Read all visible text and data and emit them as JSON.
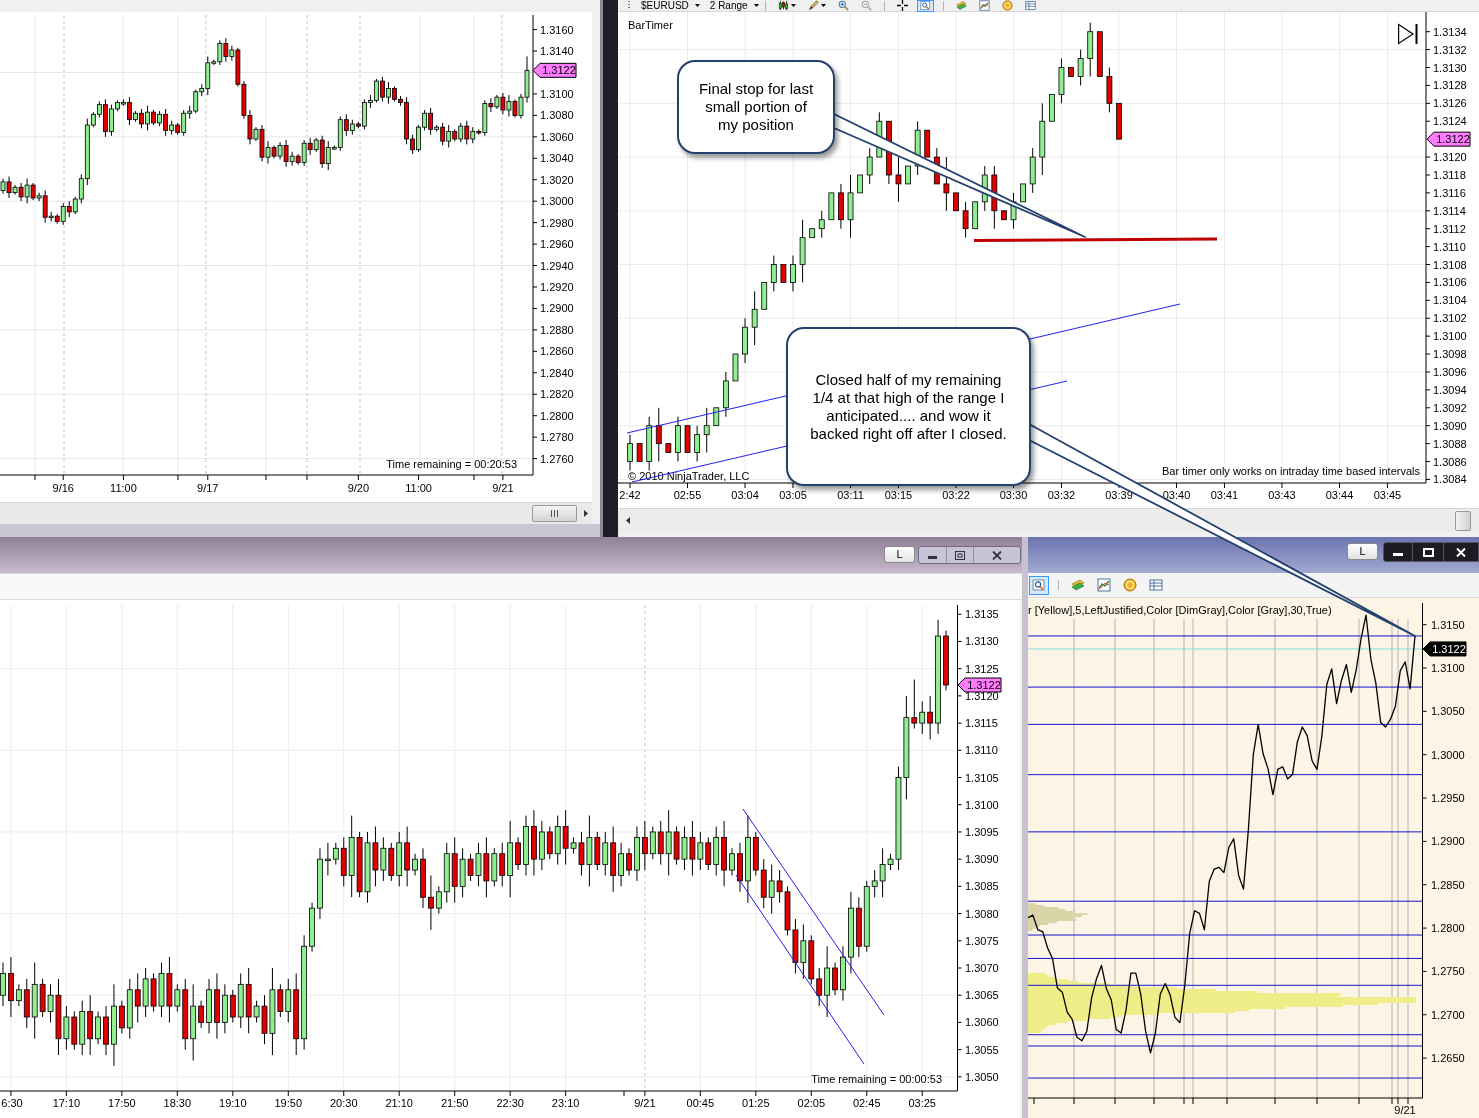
{
  "top_left_window": {
    "last_price": "1.3122",
    "timer": "Time remaining = 00:20:53",
    "chart_data": {
      "type": "candlestick",
      "grid": true,
      "ylim": [
        1.27447,
        1.31736
      ],
      "yticks": [
        {
          "value": 1.316,
          "label": "1.3160"
        },
        {
          "value": 1.314,
          "label": "1.3140"
        },
        {
          "value": 1.31,
          "label": "1.3100"
        },
        {
          "value": 1.308,
          "label": "1.3080"
        },
        {
          "value": 1.306,
          "label": "1.3060"
        },
        {
          "value": 1.304,
          "label": "1.3040"
        },
        {
          "value": 1.302,
          "label": "1.3020"
        },
        {
          "value": 1.3,
          "label": "1.3000"
        },
        {
          "value": 1.298,
          "label": "1.2980"
        },
        {
          "value": 1.296,
          "label": "1.2960"
        },
        {
          "value": 1.294,
          "label": "1.2940"
        },
        {
          "value": 1.292,
          "label": "1.2920"
        },
        {
          "value": 1.29,
          "label": "1.2900"
        },
        {
          "value": 1.288,
          "label": "1.2880"
        },
        {
          "value": 1.286,
          "label": "1.2860"
        },
        {
          "value": 1.284,
          "label": "1.2840"
        },
        {
          "value": 1.282,
          "label": "1.2820"
        },
        {
          "value": 1.28,
          "label": "1.2800"
        },
        {
          "value": 1.278,
          "label": "1.2780"
        },
        {
          "value": 1.276,
          "label": "1.2760"
        }
      ],
      "categories": [
        null,
        null,
        null,
        null,
        null,
        null,
        null,
        null,
        null,
        null,
        "9/16",
        null,
        null,
        null,
        null,
        null,
        null,
        null,
        null,
        null,
        "11:00",
        null,
        null,
        null,
        null,
        null,
        null,
        null,
        null,
        null,
        null,
        null,
        null,
        null,
        "9/17",
        null,
        null,
        null,
        null,
        null,
        null,
        null,
        null,
        null,
        null,
        null,
        null,
        null,
        null,
        null,
        null,
        null,
        null,
        null,
        null,
        null,
        null,
        null,
        null,
        "9/20",
        null,
        null,
        null,
        null,
        null,
        null,
        null,
        null,
        null,
        "11:00",
        null,
        null,
        null,
        null,
        null,
        null,
        null,
        null,
        null,
        null,
        null,
        null,
        null,
        "9/21",
        null,
        null,
        null,
        null
      ],
      "ohlc": [
        [
          1.301,
          1.3021,
          1.3007,
          1.3018
        ],
        [
          1.3018,
          1.3023,
          1.3003,
          1.3008
        ],
        [
          1.3008,
          1.3015,
          1.3006,
          1.3013
        ],
        [
          1.3013,
          1.3017,
          1.3,
          1.3004
        ],
        [
          1.3004,
          1.3021,
          1.2998,
          1.3015
        ],
        [
          1.3015,
          1.3017,
          1.3001,
          1.3003
        ],
        [
          1.3003,
          1.3008,
          1.3,
          1.3005
        ],
        [
          1.3005,
          1.301,
          1.298,
          1.2985
        ],
        [
          1.2985,
          1.299,
          1.2981,
          1.2986
        ],
        [
          1.2986,
          1.2988,
          1.2979,
          1.2981
        ],
        [
          1.2981,
          1.2998,
          1.2978,
          1.2995
        ],
        [
          1.2995,
          1.3,
          1.2985,
          1.299
        ],
        [
          1.299,
          1.3004,
          1.2988,
          1.3002
        ],
        [
          1.3002,
          1.3025,
          1.2998,
          1.3021
        ],
        [
          1.3021,
          1.3077,
          1.3015,
          1.3071
        ],
        [
          1.3071,
          1.3083,
          1.3069,
          1.3081
        ],
        [
          1.3081,
          1.3093,
          1.3078,
          1.309
        ],
        [
          1.309,
          1.3095,
          1.306,
          1.3065
        ],
        [
          1.3065,
          1.309,
          1.3061,
          1.3086
        ],
        [
          1.3086,
          1.3094,
          1.3084,
          1.3092
        ],
        [
          1.3092,
          1.3095,
          1.3089,
          1.3092
        ],
        [
          1.3092,
          1.3097,
          1.3071,
          1.3076
        ],
        [
          1.3076,
          1.3084,
          1.3074,
          1.3082
        ],
        [
          1.3082,
          1.3086,
          1.3068,
          1.3072
        ],
        [
          1.3072,
          1.3089,
          1.3066,
          1.3083
        ],
        [
          1.3083,
          1.3085,
          1.3071,
          1.3073
        ],
        [
          1.3073,
          1.3084,
          1.307,
          1.3081
        ],
        [
          1.3081,
          1.3086,
          1.3061,
          1.3066
        ],
        [
          1.3066,
          1.3075,
          1.3062,
          1.3071
        ],
        [
          1.3071,
          1.3073,
          1.3062,
          1.3064
        ],
        [
          1.3064,
          1.3085,
          1.3061,
          1.3082
        ],
        [
          1.3082,
          1.3089,
          1.3077,
          1.3084
        ],
        [
          1.3084,
          1.3104,
          1.3082,
          1.3102
        ],
        [
          1.3102,
          1.3109,
          1.3098,
          1.3105
        ],
        [
          1.3105,
          1.3135,
          1.3099,
          1.3129
        ],
        [
          1.3129,
          1.3132,
          1.3127,
          1.313
        ],
        [
          1.313,
          1.315,
          1.3127,
          1.3147
        ],
        [
          1.3147,
          1.3152,
          1.313,
          1.3135
        ],
        [
          1.3135,
          1.3145,
          1.3131,
          1.3141
        ],
        [
          1.3141,
          1.3143,
          1.3107,
          1.3109
        ],
        [
          1.3109,
          1.3112,
          1.3077,
          1.308
        ],
        [
          1.308,
          1.3085,
          1.3053,
          1.3058
        ],
        [
          1.3058,
          1.3069,
          1.3056,
          1.3067
        ],
        [
          1.3067,
          1.3071,
          1.3037,
          1.3041
        ],
        [
          1.3041,
          1.3056,
          1.3035,
          1.305
        ],
        [
          1.305,
          1.3052,
          1.304,
          1.3042
        ],
        [
          1.3042,
          1.3055,
          1.3039,
          1.3052
        ],
        [
          1.3052,
          1.3057,
          1.3032,
          1.3037
        ],
        [
          1.3037,
          1.3046,
          1.3033,
          1.3042
        ],
        [
          1.3042,
          1.3044,
          1.3034,
          1.3036
        ],
        [
          1.3036,
          1.3057,
          1.3033,
          1.3054
        ],
        [
          1.3054,
          1.3059,
          1.3043,
          1.3048
        ],
        [
          1.3048,
          1.3059,
          1.3046,
          1.3057
        ],
        [
          1.3057,
          1.3061,
          1.3031,
          1.3035
        ],
        [
          1.3035,
          1.3056,
          1.3029,
          1.305
        ],
        [
          1.305,
          1.3052,
          1.3048,
          1.305
        ],
        [
          1.305,
          1.3079,
          1.3047,
          1.3076
        ],
        [
          1.3076,
          1.3081,
          1.3061,
          1.3066
        ],
        [
          1.3066,
          1.3076,
          1.3062,
          1.3072
        ],
        [
          1.3072,
          1.3074,
          1.3068,
          1.307
        ],
        [
          1.307,
          1.3095,
          1.3067,
          1.3092
        ],
        [
          1.3092,
          1.3099,
          1.3087,
          1.3094
        ],
        [
          1.3094,
          1.3114,
          1.3092,
          1.3112
        ],
        [
          1.3112,
          1.3116,
          1.3093,
          1.3097
        ],
        [
          1.3097,
          1.3111,
          1.3091,
          1.3105
        ],
        [
          1.3105,
          1.3107,
          1.3093,
          1.3095
        ],
        [
          1.3095,
          1.3098,
          1.3089,
          1.3092
        ],
        [
          1.3092,
          1.3097,
          1.3053,
          1.3058
        ],
        [
          1.3058,
          1.3062,
          1.3044,
          1.3048
        ],
        [
          1.3048,
          1.3071,
          1.3046,
          1.3069
        ],
        [
          1.3069,
          1.3085,
          1.3066,
          1.3082
        ],
        [
          1.3082,
          1.3087,
          1.3062,
          1.3067
        ],
        [
          1.3067,
          1.3071,
          1.3065,
          1.3069
        ],
        [
          1.3069,
          1.3073,
          1.3052,
          1.3056
        ],
        [
          1.3056,
          1.3071,
          1.305,
          1.3065
        ],
        [
          1.3065,
          1.3067,
          1.3056,
          1.3058
        ],
        [
          1.3058,
          1.3073,
          1.3055,
          1.307
        ],
        [
          1.307,
          1.3075,
          1.3053,
          1.3058
        ],
        [
          1.3058,
          1.3069,
          1.3054,
          1.3065
        ],
        [
          1.3065,
          1.3067,
          1.3062,
          1.3064
        ],
        [
          1.3064,
          1.3094,
          1.3061,
          1.3091
        ],
        [
          1.3091,
          1.3096,
          1.3083,
          1.3088
        ],
        [
          1.3088,
          1.3099,
          1.3086,
          1.3097
        ],
        [
          1.3097,
          1.3101,
          1.3081,
          1.3085
        ],
        [
          1.3085,
          1.3099,
          1.3079,
          1.3093
        ],
        [
          1.3093,
          1.3095,
          1.3078,
          1.308
        ],
        [
          1.308,
          1.31,
          1.3077,
          1.3097
        ],
        [
          1.3097,
          1.3135,
          1.3092,
          1.3122
        ]
      ]
    }
  },
  "top_right_window": {
    "toolbar": {
      "instrument": "$EURUSD",
      "interval": "2 Range"
    },
    "tools": [
      {
        "kind": "candles",
        "selected": false
      },
      {
        "kind": "pencil",
        "selected": false
      },
      {
        "kind": "zoom-in",
        "selected": false
      },
      {
        "kind": "zoom-out",
        "selected": false
      },
      {
        "kind": "crosshair",
        "selected": false
      },
      {
        "kind": "magnifier",
        "selected": true
      },
      {
        "kind": "banknotes",
        "selected": false
      },
      {
        "kind": "line-chart",
        "selected": false
      },
      {
        "kind": "coin",
        "selected": false
      },
      {
        "kind": "table",
        "selected": false
      }
    ],
    "indicator": "BarTimer",
    "last_price": "1.3122",
    "copyright": "© 2010 NinjaTrader, LLC",
    "notice": "Bar timer only works on intraday time based intervals",
    "chart_data": {
      "type": "candlestick",
      "grid": true,
      "ylim": [
        1.30836,
        1.31362
      ],
      "yticks": [
        {
          "value": 1.3134,
          "label": "1.3134"
        },
        {
          "value": 1.3132,
          "label": "1.3132"
        },
        {
          "value": 1.313,
          "label": "1.3130"
        },
        {
          "value": 1.3128,
          "label": "1.3128"
        },
        {
          "value": 1.3126,
          "label": "1.3126"
        },
        {
          "value": 1.3124,
          "label": "1.3124"
        },
        {
          "value": 1.312,
          "label": "1.3120"
        },
        {
          "value": 1.3118,
          "label": "1.3118"
        },
        {
          "value": 1.3116,
          "label": "1.3116"
        },
        {
          "value": 1.3114,
          "label": "1.3114"
        },
        {
          "value": 1.3112,
          "label": "1.3112"
        },
        {
          "value": 1.311,
          "label": "1.3110"
        },
        {
          "value": 1.3108,
          "label": "1.3108"
        },
        {
          "value": 1.3106,
          "label": "1.3106"
        },
        {
          "value": 1.3104,
          "label": "1.3104"
        },
        {
          "value": 1.3102,
          "label": "1.3102"
        },
        {
          "value": 1.31,
          "label": "1.3100"
        },
        {
          "value": 1.3098,
          "label": "1.3098"
        },
        {
          "value": 1.3096,
          "label": "1.3096"
        },
        {
          "value": 1.3094,
          "label": "1.3094"
        },
        {
          "value": 1.3092,
          "label": "1.3092"
        },
        {
          "value": 1.309,
          "label": "1.3090"
        },
        {
          "value": 1.3088,
          "label": "1.3088"
        },
        {
          "value": 1.3086,
          "label": "1.3086"
        },
        {
          "value": 1.3084,
          "label": "1.3084"
        }
      ],
      "categories": [
        "2:42",
        null,
        null,
        null,
        null,
        null,
        "02:55",
        null,
        null,
        null,
        null,
        null,
        "03:04",
        null,
        null,
        null,
        null,
        "03:05",
        null,
        null,
        null,
        null,
        null,
        "03:11",
        null,
        null,
        null,
        null,
        "03:15",
        null,
        null,
        null,
        null,
        null,
        "03:22",
        null,
        null,
        null,
        null,
        null,
        "03:30",
        null,
        null,
        null,
        null,
        "03:32",
        null,
        null,
        null,
        null,
        null,
        "03:39",
        null,
        null,
        null,
        null,
        null,
        "03:40",
        null,
        null,
        null,
        null,
        "03:41",
        null,
        null,
        null,
        null,
        null,
        "03:43",
        null,
        null,
        null,
        null,
        null,
        "03:44",
        null,
        null,
        null,
        null,
        "03:45",
        null,
        null,
        null,
        null
      ],
      "ohlc": [
        [
          1.3086,
          1.3089,
          1.3085,
          1.3088
        ],
        [
          1.3088,
          1.3088,
          1.3086,
          1.3086
        ],
        [
          1.3086,
          1.3091,
          1.3085,
          1.309
        ],
        [
          1.309,
          1.3092,
          1.3086,
          1.3088
        ],
        [
          1.3088,
          1.3088,
          1.3087,
          1.3087
        ],
        [
          1.3087,
          1.3091,
          1.3086,
          1.309
        ],
        [
          1.309,
          1.309,
          1.3087,
          1.3087
        ],
        [
          1.3087,
          1.309,
          1.3086,
          1.3089
        ],
        [
          1.3089,
          1.3092,
          1.3087,
          1.309
        ],
        [
          1.309,
          1.3092,
          1.309,
          1.3092
        ],
        [
          1.3092,
          1.3096,
          1.3091,
          1.3095
        ],
        [
          1.3095,
          1.3098,
          1.3095,
          1.3098
        ],
        [
          1.3098,
          1.3102,
          1.3097,
          1.3101
        ],
        [
          1.3101,
          1.3105,
          1.3099,
          1.3103
        ],
        [
          1.3103,
          1.3106,
          1.3103,
          1.3106
        ],
        [
          1.3106,
          1.3109,
          1.3105,
          1.3108
        ],
        [
          1.3108,
          1.3108,
          1.3106,
          1.3106
        ],
        [
          1.3106,
          1.3109,
          1.3105,
          1.3108
        ],
        [
          1.3108,
          1.3113,
          1.3106,
          1.3111
        ],
        [
          1.3111,
          1.3112,
          1.3111,
          1.3112
        ],
        [
          1.3112,
          1.3114,
          1.3111,
          1.3113
        ],
        [
          1.3113,
          1.3116,
          1.3113,
          1.3116
        ],
        [
          1.3116,
          1.3117,
          1.3112,
          1.3113
        ],
        [
          1.3113,
          1.3118,
          1.3111,
          1.3116
        ],
        [
          1.3116,
          1.3118,
          1.3116,
          1.3118
        ],
        [
          1.3118,
          1.3121,
          1.3117,
          1.312
        ],
        [
          1.312,
          1.3125,
          1.312,
          1.3124
        ],
        [
          1.3124,
          1.3124,
          1.3117,
          1.3118
        ],
        [
          1.3118,
          1.312,
          1.3115,
          1.3117
        ],
        [
          1.3117,
          1.3119,
          1.3117,
          1.3119
        ],
        [
          1.3119,
          1.3124,
          1.3118,
          1.3123
        ],
        [
          1.3123,
          1.3123,
          1.312,
          1.312
        ],
        [
          1.312,
          1.3121,
          1.3117,
          1.3117
        ],
        [
          1.3117,
          1.312,
          1.3114,
          1.3116
        ],
        [
          1.3116,
          1.3116,
          1.3114,
          1.3114
        ],
        [
          1.3114,
          1.3115,
          1.3111,
          1.3112
        ],
        [
          1.3112,
          1.3115,
          1.3112,
          1.3115
        ],
        [
          1.3115,
          1.3119,
          1.3114,
          1.3118
        ],
        [
          1.3118,
          1.3119,
          1.3112,
          1.3114
        ],
        [
          1.3114,
          1.3114,
          1.3113,
          1.3113
        ],
        [
          1.3113,
          1.3116,
          1.3112,
          1.3115
        ],
        [
          1.3115,
          1.3117,
          1.3115,
          1.3117
        ],
        [
          1.3117,
          1.3121,
          1.3116,
          1.312
        ],
        [
          1.312,
          1.3126,
          1.3118,
          1.3124
        ],
        [
          1.3124,
          1.3127,
          1.3124,
          1.3127
        ],
        [
          1.3127,
          1.3131,
          1.3126,
          1.313
        ],
        [
          1.313,
          1.313,
          1.3129,
          1.3129
        ],
        [
          1.3129,
          1.3132,
          1.3128,
          1.3131
        ],
        [
          1.3131,
          1.3135,
          1.3129,
          1.3134
        ],
        [
          1.3134,
          1.3134,
          1.3129,
          1.3129
        ],
        [
          1.3129,
          1.313,
          1.3125,
          1.3126
        ],
        [
          1.3126,
          1.3126,
          1.3122,
          1.3122
        ],
        null,
        null,
        null,
        null,
        null,
        null,
        null,
        null,
        null,
        null,
        null,
        null,
        null,
        null,
        null,
        null,
        null,
        null,
        null,
        null,
        null,
        null,
        null,
        null,
        null,
        null,
        null,
        null,
        null,
        null,
        null,
        null
      ]
    }
  },
  "callouts": [
    {
      "text": "Final stop for last\nsmall portion of\nmy position"
    },
    {
      "text": "Closed half of my remaining\n1/4 at that high of the range I\nanticipated.... and wow it\nbacked right off after I closed."
    }
  ],
  "bottom_left_window": {
    "title_bar": {
      "button": "L"
    },
    "last_price": "1.3122",
    "timer": "Time remaining = 00:00:53",
    "chart_data": {
      "type": "candlestick",
      "grid": true,
      "ylim": [
        1.30474,
        1.31367
      ],
      "yticks": [
        {
          "value": 1.3135,
          "label": "1.3135"
        },
        {
          "value": 1.313,
          "label": "1.3130"
        },
        {
          "value": 1.3125,
          "label": "1.3125"
        },
        {
          "value": 1.312,
          "label": "1.3120"
        },
        {
          "value": 1.3115,
          "label": "1.3115"
        },
        {
          "value": 1.311,
          "label": "1.3110"
        },
        {
          "value": 1.3105,
          "label": "1.3105"
        },
        {
          "value": 1.31,
          "label": "1.3100"
        },
        {
          "value": 1.3095,
          "label": "1.3095"
        },
        {
          "value": 1.309,
          "label": "1.3090"
        },
        {
          "value": 1.3085,
          "label": "1.3085"
        },
        {
          "value": 1.308,
          "label": "1.3080"
        },
        {
          "value": 1.3075,
          "label": "1.3075"
        },
        {
          "value": 1.307,
          "label": "1.3070"
        },
        {
          "value": 1.3065,
          "label": "1.3065"
        },
        {
          "value": 1.306,
          "label": "1.3060"
        },
        {
          "value": 1.3055,
          "label": "1.3055"
        },
        {
          "value": 1.305,
          "label": "1.3050"
        }
      ],
      "categories": [
        null,
        "6:30",
        null,
        null,
        null,
        null,
        null,
        null,
        "17:10",
        null,
        null,
        null,
        null,
        null,
        null,
        "17:50",
        null,
        null,
        null,
        null,
        null,
        null,
        "18:30",
        null,
        null,
        null,
        null,
        null,
        null,
        "19:10",
        null,
        null,
        null,
        null,
        null,
        null,
        "19:50",
        null,
        null,
        null,
        null,
        null,
        null,
        "20:30",
        null,
        null,
        null,
        null,
        null,
        null,
        "21:10",
        null,
        null,
        null,
        null,
        null,
        null,
        "21:50",
        null,
        null,
        null,
        null,
        null,
        null,
        "22:30",
        null,
        null,
        null,
        null,
        null,
        null,
        "23:10",
        null,
        null,
        null,
        null,
        null,
        null,
        null,
        null,
        null,
        "9/21",
        null,
        null,
        null,
        null,
        null,
        null,
        "00:45",
        null,
        null,
        null,
        null,
        null,
        null,
        "01:25",
        null,
        null,
        null,
        null,
        null,
        null,
        "02:05",
        null,
        null,
        null,
        null,
        null,
        null,
        "02:45",
        null,
        null,
        null,
        null,
        null,
        null,
        "03:25",
        null,
        null,
        null
      ],
      "ohlc": [
        [
          1.3065,
          1.3071,
          1.3063,
          1.3069
        ],
        [
          1.3069,
          1.3072,
          1.3061,
          1.3064
        ],
        [
          1.3064,
          1.3067,
          1.3063,
          1.3066
        ],
        [
          1.3066,
          1.3068,
          1.3059,
          1.3061
        ],
        [
          1.3061,
          1.3071,
          1.3057,
          1.3067
        ],
        [
          1.3067,
          1.3068,
          1.3061,
          1.3062
        ],
        [
          1.3062,
          1.3067,
          1.306,
          1.3065
        ],
        [
          1.3065,
          1.3068,
          1.3054,
          1.3057
        ],
        [
          1.3057,
          1.3063,
          1.3055,
          1.3061
        ],
        [
          1.3061,
          1.3062,
          1.3055,
          1.3056
        ],
        [
          1.3056,
          1.3064,
          1.3054,
          1.3062
        ],
        [
          1.3062,
          1.3065,
          1.3054,
          1.3057
        ],
        [
          1.3057,
          1.3062,
          1.3056,
          1.3061
        ],
        [
          1.3061,
          1.3063,
          1.3054,
          1.3056
        ],
        [
          1.3056,
          1.3067,
          1.3052,
          1.3063
        ],
        [
          1.3063,
          1.3064,
          1.3058,
          1.3059
        ],
        [
          1.3059,
          1.3068,
          1.3057,
          1.3066
        ],
        [
          1.3066,
          1.3069,
          1.306,
          1.3063
        ],
        [
          1.3063,
          1.307,
          1.3061,
          1.3068
        ],
        [
          1.3068,
          1.3069,
          1.3062,
          1.3063
        ],
        [
          1.3063,
          1.3071,
          1.3061,
          1.3069
        ],
        [
          1.3069,
          1.3072,
          1.306,
          1.3063
        ],
        [
          1.3063,
          1.3067,
          1.3062,
          1.3066
        ],
        [
          1.3066,
          1.3068,
          1.3055,
          1.3057
        ],
        [
          1.3057,
          1.3067,
          1.3053,
          1.3063
        ],
        [
          1.3063,
          1.3064,
          1.3059,
          1.306
        ],
        [
          1.306,
          1.3068,
          1.3058,
          1.3066
        ],
        [
          1.3066,
          1.3069,
          1.3057,
          1.306
        ],
        [
          1.306,
          1.3067,
          1.3058,
          1.3065
        ],
        [
          1.3065,
          1.3066,
          1.306,
          1.3061
        ],
        [
          1.3061,
          1.3069,
          1.3059,
          1.3067
        ],
        [
          1.3067,
          1.307,
          1.3058,
          1.3061
        ],
        [
          1.3061,
          1.3064,
          1.306,
          1.3063
        ],
        [
          1.3063,
          1.3065,
          1.3056,
          1.3058
        ],
        [
          1.3058,
          1.307,
          1.3054,
          1.3066
        ],
        [
          1.3066,
          1.3067,
          1.3061,
          1.3062
        ],
        [
          1.3062,
          1.3068,
          1.306,
          1.3066
        ],
        [
          1.3066,
          1.3069,
          1.3054,
          1.3057
        ],
        [
          1.3057,
          1.3076,
          1.3055,
          1.3074
        ],
        [
          1.3074,
          1.3082,
          1.3073,
          1.3081
        ],
        [
          1.3081,
          1.3092,
          1.3079,
          1.309
        ],
        [
          1.309,
          1.3093,
          1.3087,
          1.309
        ],
        [
          1.309,
          1.3093,
          1.3089,
          1.3092
        ],
        [
          1.3092,
          1.3094,
          1.3085,
          1.3087
        ],
        [
          1.3087,
          1.3098,
          1.3083,
          1.3094
        ],
        [
          1.3094,
          1.3095,
          1.3083,
          1.3084
        ],
        [
          1.3084,
          1.3095,
          1.3082,
          1.3093
        ],
        [
          1.3093,
          1.3096,
          1.3085,
          1.3088
        ],
        [
          1.3088,
          1.3094,
          1.3086,
          1.3092
        ],
        [
          1.3092,
          1.3093,
          1.3086,
          1.3087
        ],
        [
          1.3087,
          1.3095,
          1.3085,
          1.3093
        ],
        [
          1.3093,
          1.3096,
          1.3085,
          1.3088
        ],
        [
          1.3088,
          1.3091,
          1.3087,
          1.309
        ],
        [
          1.309,
          1.3092,
          1.3081,
          1.3083
        ],
        [
          1.3083,
          1.3087,
          1.3077,
          1.3081
        ],
        [
          1.3081,
          1.3085,
          1.308,
          1.3084
        ],
        [
          1.3084,
          1.3093,
          1.3082,
          1.3091
        ],
        [
          1.3091,
          1.3094,
          1.3082,
          1.3085
        ],
        [
          1.3085,
          1.3092,
          1.3083,
          1.309
        ],
        [
          1.309,
          1.3091,
          1.3086,
          1.3087
        ],
        [
          1.3087,
          1.3093,
          1.3085,
          1.3091
        ],
        [
          1.3091,
          1.3094,
          1.3083,
          1.3086
        ],
        [
          1.3086,
          1.3092,
          1.3085,
          1.3091
        ],
        [
          1.3091,
          1.3093,
          1.3085,
          1.3087
        ],
        [
          1.3087,
          1.3097,
          1.3083,
          1.3093
        ],
        [
          1.3093,
          1.3094,
          1.3088,
          1.3089
        ],
        [
          1.3089,
          1.3098,
          1.3087,
          1.3096
        ],
        [
          1.3096,
          1.3099,
          1.3087,
          1.309
        ],
        [
          1.309,
          1.3097,
          1.3088,
          1.3095
        ],
        [
          1.3095,
          1.3096,
          1.309,
          1.3091
        ],
        [
          1.3091,
          1.3098,
          1.3089,
          1.3096
        ],
        [
          1.3096,
          1.3099,
          1.3089,
          1.3092
        ],
        [
          1.3092,
          1.3094,
          1.3091,
          1.3093
        ],
        [
          1.3093,
          1.3095,
          1.3087,
          1.3089
        ],
        [
          1.3089,
          1.3098,
          1.3085,
          1.3094
        ],
        [
          1.3094,
          1.3095,
          1.3088,
          1.3089
        ],
        [
          1.3089,
          1.3095,
          1.3087,
          1.3093
        ],
        [
          1.3093,
          1.3096,
          1.3084,
          1.3087
        ],
        [
          1.3087,
          1.3093,
          1.3085,
          1.3091
        ],
        [
          1.3091,
          1.3092,
          1.3087,
          1.3088
        ],
        [
          1.3088,
          1.3096,
          1.3086,
          1.3094
        ],
        [
          1.3094,
          1.3097,
          1.3088,
          1.3091
        ],
        [
          1.3091,
          1.3096,
          1.309,
          1.3095
        ],
        [
          1.3095,
          1.3097,
          1.3089,
          1.3091
        ],
        [
          1.3091,
          1.3099,
          1.3087,
          1.3095
        ],
        [
          1.3095,
          1.3096,
          1.3089,
          1.309
        ],
        [
          1.309,
          1.3096,
          1.3088,
          1.3094
        ],
        [
          1.3094,
          1.3097,
          1.3087,
          1.309
        ],
        [
          1.309,
          1.3095,
          1.3088,
          1.3093
        ],
        [
          1.3093,
          1.3094,
          1.3088,
          1.3089
        ],
        [
          1.3089,
          1.3096,
          1.3087,
          1.3094
        ],
        [
          1.3094,
          1.3097,
          1.3085,
          1.3088
        ],
        [
          1.3088,
          1.3092,
          1.3087,
          1.3091
        ],
        [
          1.3091,
          1.3093,
          1.3084,
          1.3086
        ],
        [
          1.3086,
          1.3098,
          1.3082,
          1.3094
        ],
        [
          1.3094,
          1.3095,
          1.3087,
          1.3088
        ],
        [
          1.3088,
          1.309,
          1.3081,
          1.3083
        ],
        [
          1.3083,
          1.3089,
          1.308,
          1.3086
        ],
        [
          1.3086,
          1.3088,
          1.3082,
          1.3084
        ],
        [
          1.3084,
          1.3085,
          1.3076,
          1.3077
        ],
        [
          1.3077,
          1.3079,
          1.3069,
          1.3071
        ],
        [
          1.3071,
          1.3078,
          1.3068,
          1.3075
        ],
        [
          1.3075,
          1.3076,
          1.3067,
          1.3068
        ],
        [
          1.3068,
          1.307,
          1.3063,
          1.3065
        ],
        [
          1.3065,
          1.3074,
          1.3061,
          1.307
        ],
        [
          1.307,
          1.3071,
          1.3065,
          1.3066
        ],
        [
          1.3066,
          1.3074,
          1.3064,
          1.3072
        ],
        [
          1.3072,
          1.3084,
          1.3069,
          1.3081
        ],
        [
          1.3081,
          1.3083,
          1.3072,
          1.3074
        ],
        [
          1.3074,
          1.3086,
          1.3073,
          1.3085
        ],
        [
          1.3085,
          1.3088,
          1.3083,
          1.3086
        ],
        [
          1.3086,
          1.3092,
          1.3083,
          1.3089
        ],
        [
          1.3089,
          1.3091,
          1.3088,
          1.309
        ],
        [
          1.309,
          1.3107,
          1.3088,
          1.3105
        ],
        [
          1.3105,
          1.312,
          1.3101,
          1.3116
        ],
        [
          1.3116,
          1.3123,
          1.3114,
          1.3115
        ],
        [
          1.3115,
          1.3119,
          1.3113,
          1.3117
        ],
        [
          1.3117,
          1.312,
          1.3112,
          1.3115
        ],
        [
          1.3115,
          1.3134,
          1.3113,
          1.3131
        ],
        [
          1.3131,
          1.3132,
          1.3121,
          1.3122
        ]
      ]
    }
  },
  "bottom_right_window": {
    "title_bar": {
      "button": "L"
    },
    "tools": [
      {
        "kind": "magnifier",
        "selected": true
      },
      {
        "kind": "banknotes",
        "selected": false
      },
      {
        "kind": "line-chart",
        "selected": false
      },
      {
        "kind": "coin",
        "selected": false
      },
      {
        "kind": "table",
        "selected": false
      }
    ],
    "indicator": "r [Yellow],5,LeftJustified,Color [DimGray],Color [Gray],30,True)",
    "time_axis": [
      "9/21"
    ],
    "last_price": "1.3122",
    "chart_data": {
      "type": "line",
      "ylim": [
        1.2604,
        1.3175
      ],
      "yticks": [
        {
          "value": 1.315,
          "label": "1.3150"
        },
        {
          "value": 1.31,
          "label": "1.3100"
        },
        {
          "value": 1.305,
          "label": "1.3050"
        },
        {
          "value": 1.3,
          "label": "1.3000"
        },
        {
          "value": 1.295,
          "label": "1.2950"
        },
        {
          "value": 1.29,
          "label": "1.2900"
        },
        {
          "value": 1.285,
          "label": "1.2850"
        },
        {
          "value": 1.28,
          "label": "1.2800"
        },
        {
          "value": 1.275,
          "label": "1.2750"
        },
        {
          "value": 1.27,
          "label": "1.2700"
        },
        {
          "value": 1.265,
          "label": "1.2650"
        }
      ],
      "series": [
        {
          "color": "#000000",
          "values": [
            1.2812,
            1.2815,
            1.2798,
            1.2796,
            1.2777,
            1.2765,
            1.2731,
            1.2726,
            1.2703,
            1.2695,
            1.2674,
            1.267,
            1.2681,
            1.272,
            1.2742,
            1.2757,
            1.273,
            1.2717,
            1.2683,
            1.2679,
            1.2705,
            1.2748,
            1.2748,
            1.2724,
            1.2681,
            1.2656,
            1.2679,
            1.2724,
            1.2736,
            1.2723,
            1.2697,
            1.2691,
            1.2734,
            1.2794,
            1.282,
            1.2817,
            1.2798,
            1.2854,
            1.2868,
            1.287,
            1.2864,
            1.2893,
            1.2903,
            1.2861,
            1.2845,
            1.2914,
            1.3,
            1.3035,
            1.3001,
            1.2984,
            1.2954,
            1.2983,
            1.2986,
            1.2972,
            1.2977,
            1.3015,
            1.3032,
            1.3022,
            1.2993,
            1.2983,
            1.3022,
            1.3081,
            1.3099,
            1.3059,
            1.3086,
            1.3104,
            1.3072,
            1.3098,
            1.3134,
            1.3161,
            1.311,
            1.3083,
            1.3037,
            1.3032,
            1.3041,
            1.3056,
            1.3097,
            1.3107,
            1.3076,
            1.3137
          ]
        }
      ],
      "ref_lines": [
        {
          "axis": "y",
          "value": 1.3137,
          "color": "#1414d0"
        },
        {
          "axis": "y",
          "value": 1.3122,
          "color": "#7fe0e0"
        },
        {
          "axis": "y",
          "value": 1.3078,
          "color": "#1414d0"
        },
        {
          "axis": "y",
          "value": 1.3035,
          "color": "#1414d0"
        },
        {
          "axis": "y",
          "value": 1.2977,
          "color": "#1414d0"
        },
        {
          "axis": "y",
          "value": 1.2911,
          "color": "#1414d0"
        },
        {
          "axis": "y",
          "value": 1.2831,
          "color": "#1414d0"
        },
        {
          "axis": "y",
          "value": 1.2792,
          "color": "#1414d0"
        },
        {
          "axis": "y",
          "value": 1.2765,
          "color": "#1414d0"
        },
        {
          "axis": "y",
          "value": 1.2734,
          "color": "#1414d0"
        },
        {
          "axis": "y",
          "value": 1.2677,
          "color": "#1414d0"
        },
        {
          "axis": "y",
          "value": 1.2664,
          "color": "#1414d0"
        },
        {
          "axis": "y",
          "value": 1.2627,
          "color": "#1414d0"
        }
      ]
    }
  }
}
